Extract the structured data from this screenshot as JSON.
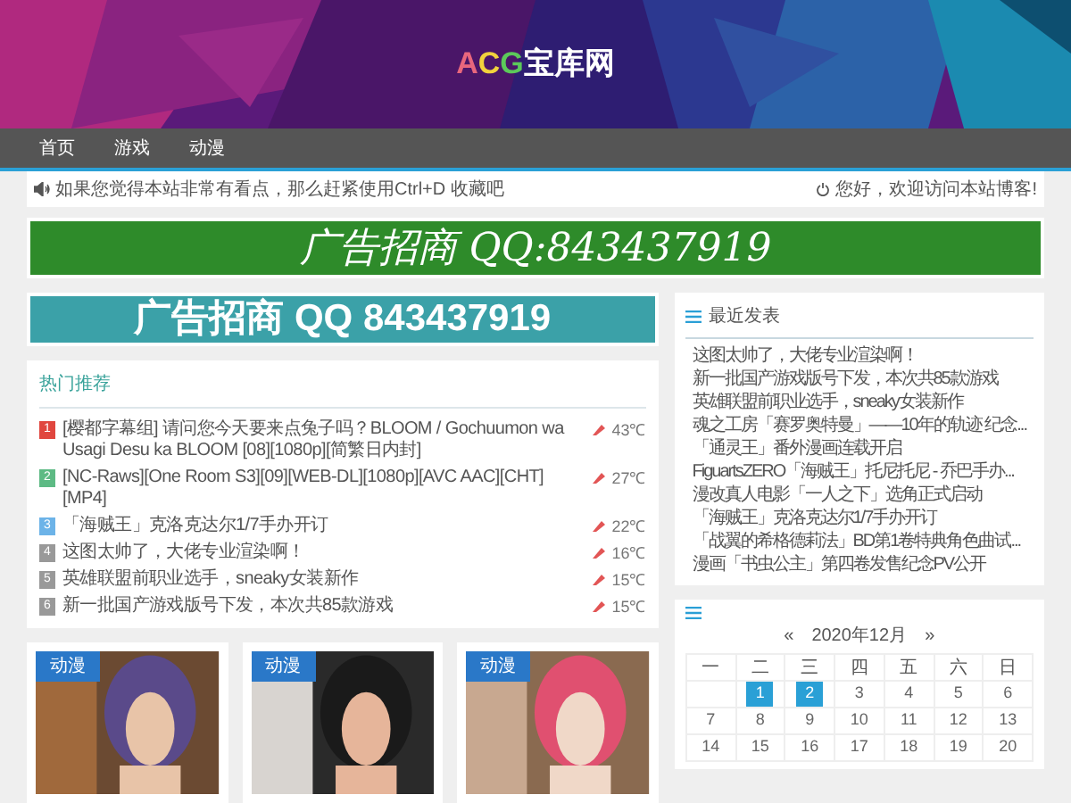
{
  "logo": [
    {
      "text": "A",
      "color": "#e8677d"
    },
    {
      "text": "C",
      "color": "#f2d23c"
    },
    {
      "text": "G",
      "color": "#5cc95a"
    },
    {
      "text": "宝库网",
      "color": "#ffffff"
    }
  ],
  "nav": [
    {
      "label": "首页"
    },
    {
      "label": "游戏"
    },
    {
      "label": "动漫"
    }
  ],
  "notice": {
    "left": "如果您觉得本站非常有看点，那么赶紧使用Ctrl+D 收藏吧",
    "right": "您好，欢迎访问本站博客!"
  },
  "ad_banner": "广告招商  QQ:843437919",
  "ad_banner_2": "广告招商 QQ 843437919",
  "hot": {
    "title": "热门推荐",
    "items": [
      {
        "rank": "1",
        "color": "#e0463e",
        "title": "[樱都字幕组] 请问您今天要来点兔子吗？BLOOM / Gochuumon wa Usagi Desu ka BLOOM [08][1080p][简繁日内封]",
        "heat": "43℃"
      },
      {
        "rank": "2",
        "color": "#5dba84",
        "title": "[NC-Raws][One Room S3][09][WEB-DL][1080p][AVC AAC][CHT][MP4]",
        "heat": "27℃"
      },
      {
        "rank": "3",
        "color": "#6cb3e8",
        "title": "「海贼王」克洛克达尔1/7手办开订",
        "heat": "22℃"
      },
      {
        "rank": "4",
        "color": "#999999",
        "title": "这图太帅了，大佬专业渲染啊！",
        "heat": "16℃"
      },
      {
        "rank": "5",
        "color": "#999999",
        "title": "英雄联盟前职业选手，sneaky女装新作",
        "heat": "15℃"
      },
      {
        "rank": "6",
        "color": "#999999",
        "title": "新一批国产游戏版号下发，本次共85款游戏",
        "heat": "15℃"
      }
    ]
  },
  "cards": [
    {
      "tag": "动漫",
      "kind": "picture"
    },
    {
      "tag": "动漫",
      "kind": "picture"
    },
    {
      "tag": "动漫",
      "kind": "picture"
    }
  ],
  "recent": {
    "title": "最近发表",
    "items": [
      "这图太帅了，大佬专业渲染啊！",
      "新一批国产游戏版号下发，本次共85款游戏",
      "英雄联盟前职业选手，sneaky女装新作",
      "魂之工房「赛罗奥特曼」——10年的轨迹 纪念...",
      "「通灵王」番外漫画连载开启",
      "FiguartsZERO「海贼王」托尼托尼 - 乔巴手办...",
      "漫改真人电影「一人之下」选角正式启动",
      "「海贼王」克洛克达尔1/7手办开订",
      "「战翼的希格德莉法」BD第1卷特典角色曲试...",
      "漫画「书虫公主」第四卷发售纪念PV公开"
    ]
  },
  "calendar": {
    "prev": "«",
    "month": "2020年12月",
    "next": "»",
    "weekdays": [
      "一",
      "二",
      "三",
      "四",
      "五",
      "六",
      "日"
    ],
    "weeks": [
      [
        {
          "day": "1",
          "has_post": true
        },
        {
          "day": "2",
          "has_post": true
        },
        {
          "day": "3",
          "has_post": false
        },
        {
          "day": "4",
          "has_post": false
        },
        {
          "day": "5",
          "has_post": false
        },
        {
          "day": "6",
          "has_post": false
        }
      ],
      [
        {
          "day": "7",
          "has_post": false
        },
        {
          "day": "8",
          "has_post": false
        },
        {
          "day": "9",
          "has_post": false
        },
        {
          "day": "10",
          "has_post": false
        },
        {
          "day": "11",
          "has_post": false
        },
        {
          "day": "12",
          "has_post": false
        },
        {
          "day": "13",
          "has_post": false
        }
      ],
      [
        {
          "day": "14",
          "has_post": false
        },
        {
          "day": "15",
          "has_post": false
        },
        {
          "day": "16",
          "has_post": false
        },
        {
          "day": "17",
          "has_post": false
        },
        {
          "day": "18",
          "has_post": false
        },
        {
          "day": "19",
          "has_post": false
        },
        {
          "day": "20",
          "has_post": false
        }
      ]
    ]
  }
}
